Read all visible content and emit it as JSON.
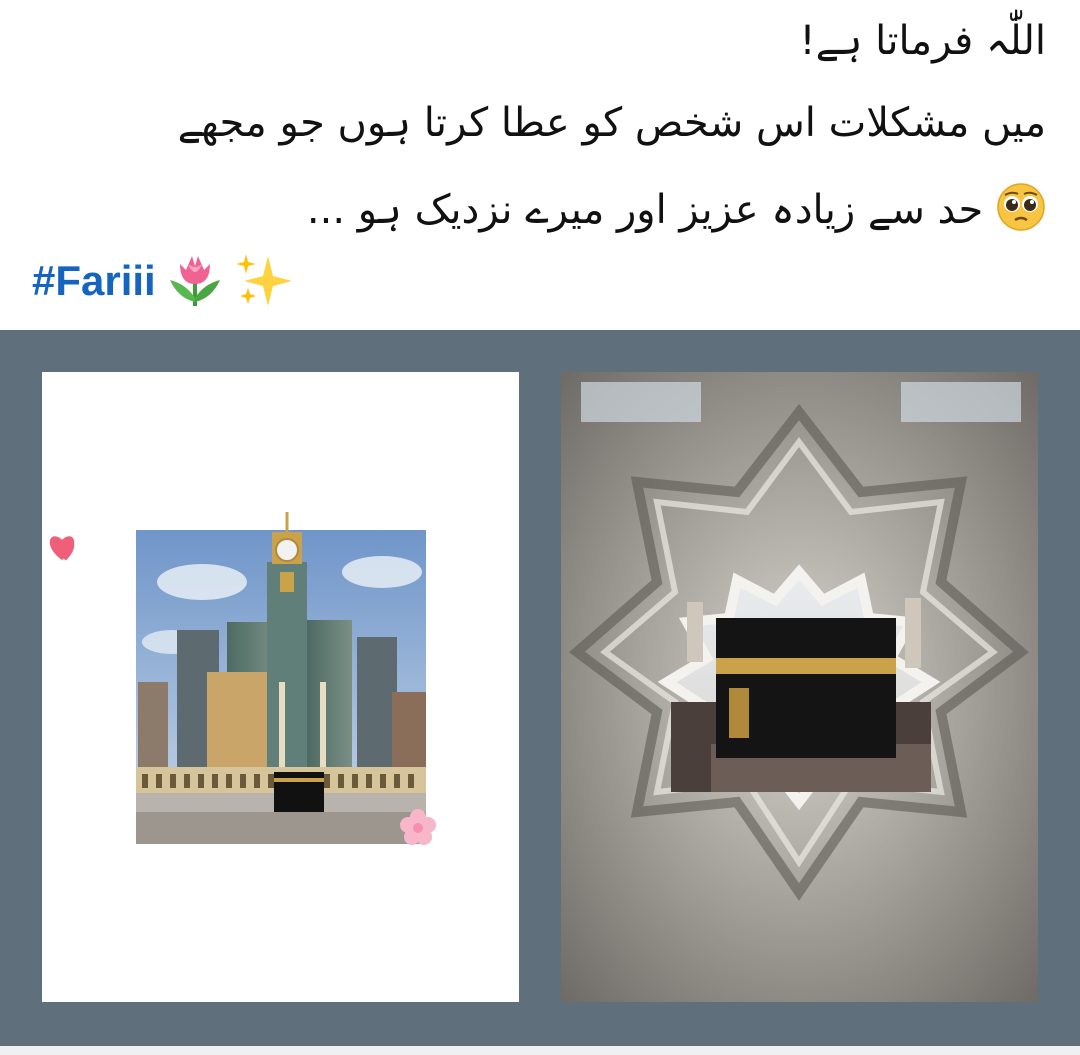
{
  "post": {
    "text_lines": [
      "اللّٰہ فرماتا ہے!",
      "میں مشکلات اس شخص کو عطا کرتا ہوں جو مجھے",
      "حد سے زیادہ عزیز اور میرے نزدیک ہو ..."
    ],
    "hashtag": "#Fariii",
    "emojis": [
      "pleading-face-icon",
      "tulip-icon",
      "sparkles-icon"
    ]
  },
  "colors": {
    "hashtag": "#1565c0",
    "gallery_background": "#5f6f7b",
    "text": "#111111"
  },
  "gallery": {
    "images": [
      {
        "name": "clock-tower-and-kaaba-photo",
        "decorations": [
          "hearts-sticker",
          "flower-sticker"
        ]
      },
      {
        "name": "kaaba-through-star-window-photo"
      }
    ]
  }
}
